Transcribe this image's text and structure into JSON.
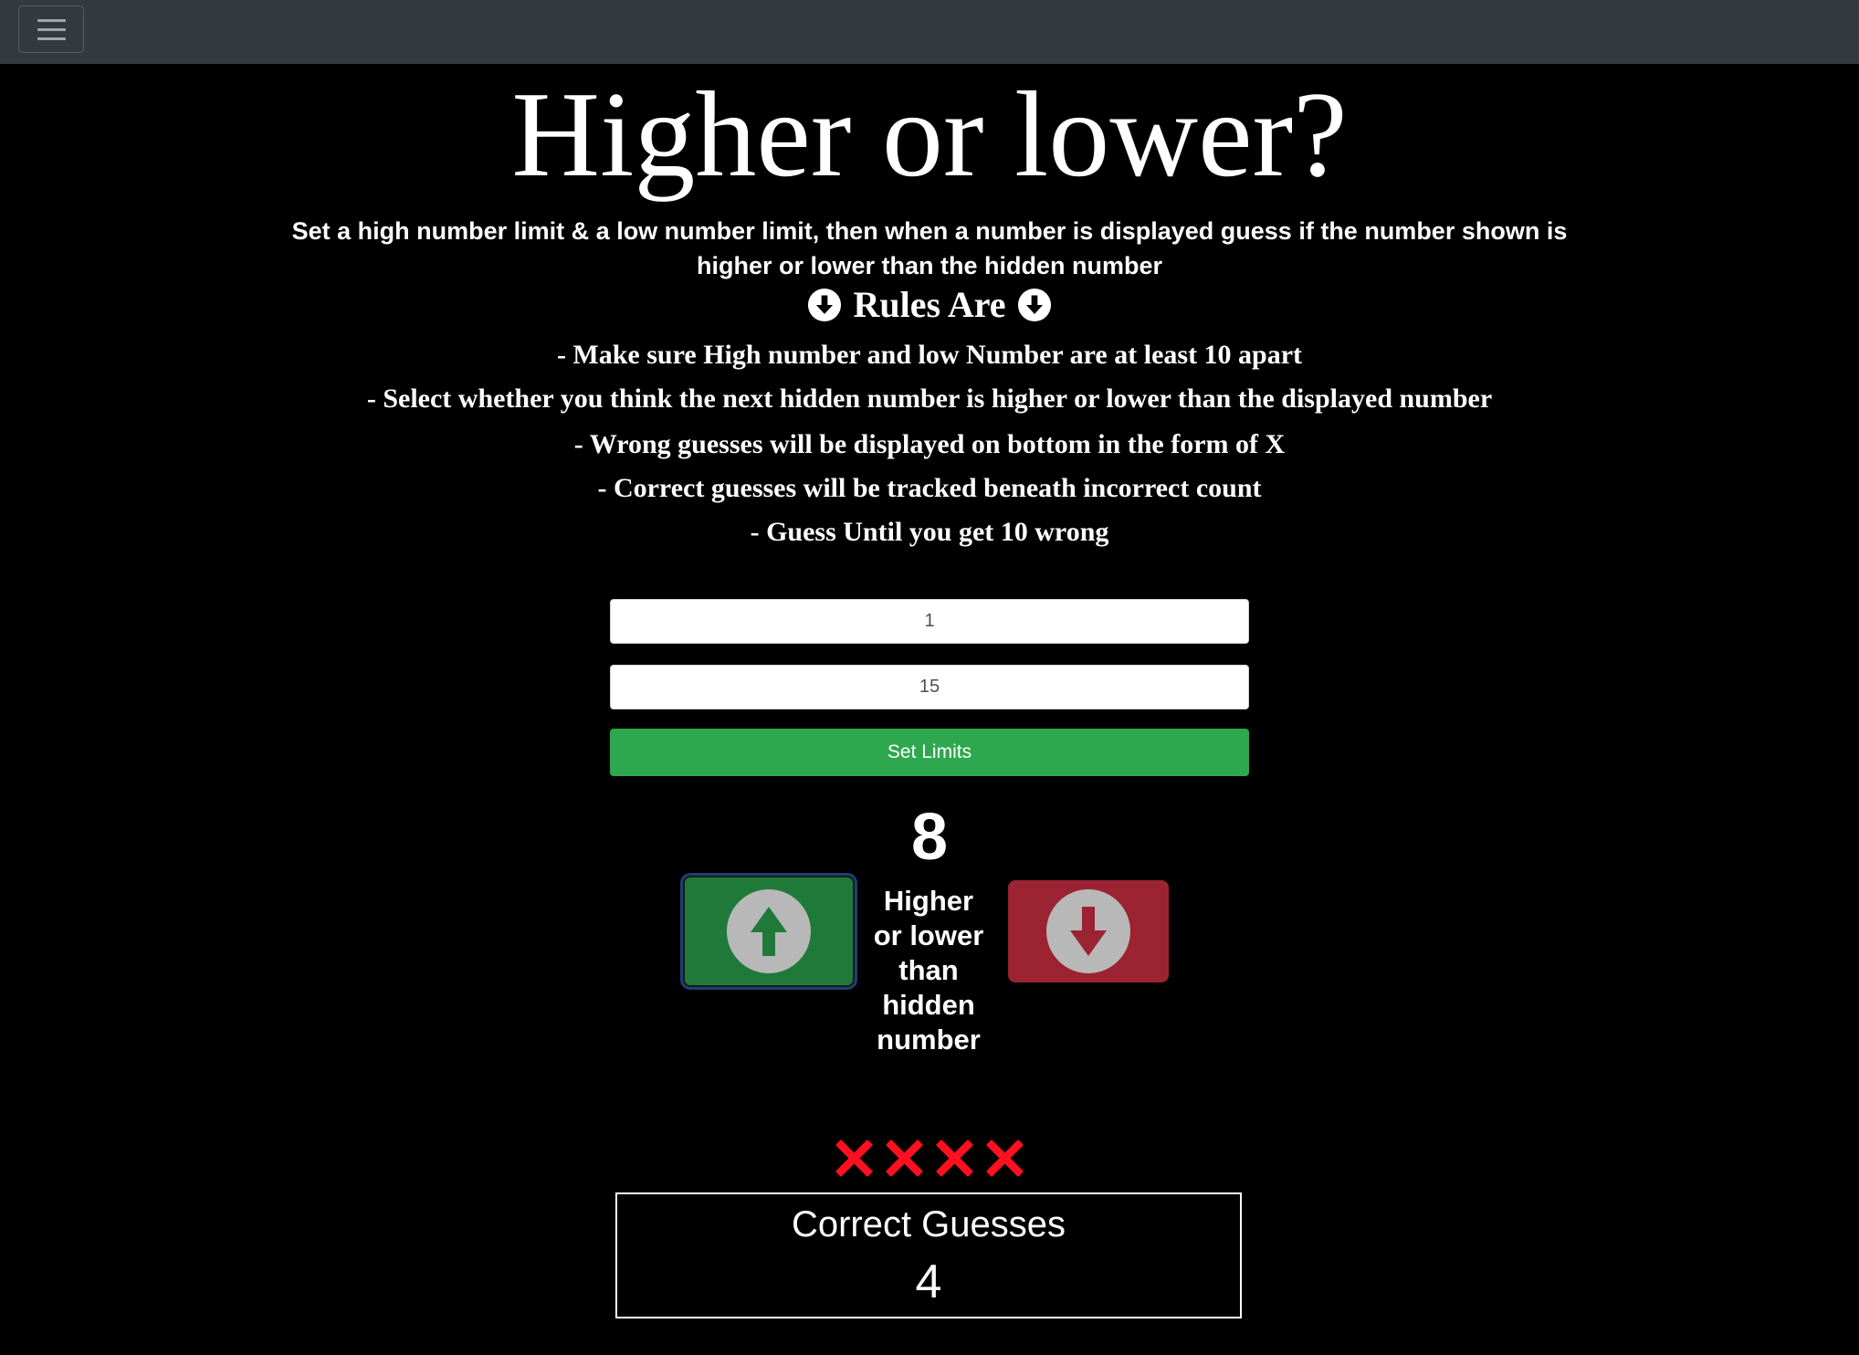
{
  "navbar": {
    "toggler_icon": "hamburger-menu-icon"
  },
  "header": {
    "title": "Higher or lower?",
    "intro_line1": "Set a high number limit & a low number limit, then when a number is displayed guess if the number shown is",
    "intro_line2": "higher or lower than the hidden number"
  },
  "rules": {
    "heading": "Rules Are",
    "heading_icon": "circle-arrow-down-icon",
    "items": [
      "- Make sure High number and low Number are at least 10 apart",
      "- Select whether you think the next hidden number is higher or lower than the displayed number",
      "- Wrong guesses will be displayed on bottom in the form of X",
      "- Correct guesses will be tracked beneath incorrect count",
      "- Guess Until you get 10 wrong"
    ]
  },
  "limits": {
    "low_value": "1",
    "high_value": "15",
    "set_button_label": "Set Limits"
  },
  "game": {
    "displayed_number": "8",
    "higher_icon": "circle-arrow-up-icon",
    "lower_icon": "circle-arrow-down-icon",
    "prompt_lines": [
      "Higher",
      "or lower",
      "than",
      "hidden",
      "number"
    ],
    "wrong_count": 4,
    "wrong_mark_icon": "red-x-icon"
  },
  "score": {
    "label": "Correct Guesses",
    "value": "4"
  },
  "colors": {
    "navbar": "#343a40",
    "background": "#000000",
    "set_button": "#2ea84e",
    "higher_button": "#1f7a3a",
    "lower_button": "#9b2332",
    "wrong_mark": "#ff0f1f"
  }
}
